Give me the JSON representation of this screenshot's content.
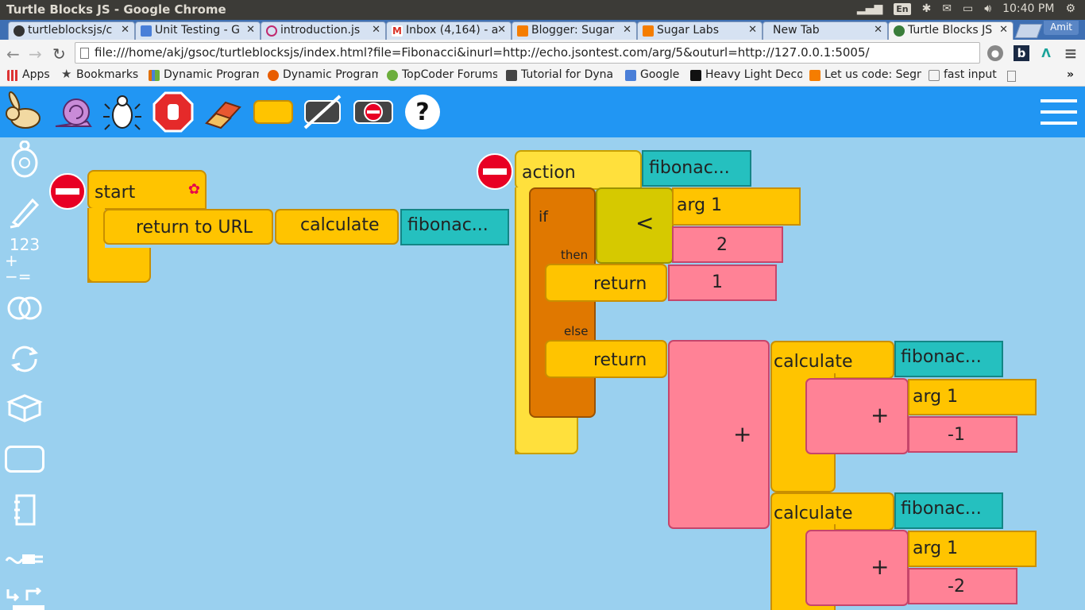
{
  "os": {
    "window_title": "Turtle Blocks JS - Google Chrome",
    "lang": "En",
    "clock": "10:40 PM"
  },
  "tabs": [
    {
      "label": "turtleblocksjs/c",
      "color": "#333333"
    },
    {
      "label": "Unit Testing - G",
      "color": "#4a7fd8"
    },
    {
      "label": "introduction.js",
      "color": "#c02a6f"
    },
    {
      "label": "Inbox (4,164) - a",
      "color": "#d93025"
    },
    {
      "label": "Blogger: Sugar",
      "color": "#f57d00"
    },
    {
      "label": "Sugar Labs",
      "color": "#f57d00"
    },
    {
      "label": "New Tab",
      "color": ""
    },
    {
      "label": "Turtle Blocks JS",
      "color": "#3a7d3a"
    }
  ],
  "user": "Amit",
  "url": "file:///home/akj/gsoc/turtleblocksjs/index.html?file=Fibonacci&inurl=http://echo.jsontest.com/arg/5&outurl=http://127.0.0.1:5005/",
  "bookmarks": [
    {
      "label": "Apps",
      "color": "#d33"
    },
    {
      "label": "Bookmarks",
      "color": ""
    },
    {
      "label": "Dynamic Program",
      "color": "#e07000"
    },
    {
      "label": "Dynamic Program",
      "color": "#e85d00"
    },
    {
      "label": "TopCoder Forums",
      "color": "#6cae3c"
    },
    {
      "label": "Tutorial for Dyna",
      "color": "#444444"
    },
    {
      "label": "Google",
      "color": "#4a7fd8"
    },
    {
      "label": "Heavy Light Deco",
      "color": "#111111"
    },
    {
      "label": "Let us code: Segm",
      "color": "#f57d00"
    },
    {
      "label": "fast input",
      "color": "#888888"
    }
  ],
  "palette": {
    "numbers_top": "123",
    "numbers_bottom": "+−="
  },
  "blocks": {
    "start": "start",
    "return_to_url": "return to URL",
    "calculate": "calculate",
    "fib_name": "fibonac...",
    "action": "action",
    "if": "if",
    "then": "then",
    "else": "else",
    "lt": "<",
    "arg1": "arg 1",
    "two": "2",
    "return": "return",
    "one": "1",
    "plus": "+",
    "minus_one": "-1",
    "minus_two": "-2"
  }
}
